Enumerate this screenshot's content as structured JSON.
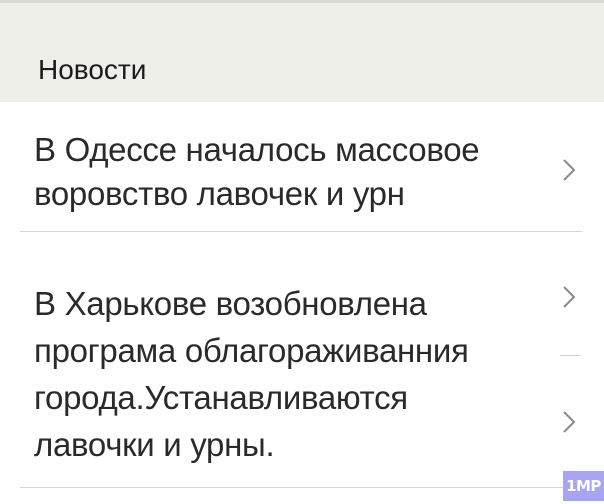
{
  "section": {
    "title": "Новости"
  },
  "news": [
    {
      "lines": [
        "В Одессе началось массовое",
        "воровство лавочек и урн"
      ]
    },
    {
      "lines": [
        "В Харькове возобновлена",
        "програма облагораживанния",
        "города.Устанавливаются",
        "лавочки и урны."
      ]
    }
  ],
  "watermark": {
    "text": "1MP"
  },
  "icons": {
    "chevron": "chevron-right-icon"
  },
  "colors": {
    "header_bg": "#efefe9",
    "text": "#2a2a2a",
    "chevron": "#8a8a8a",
    "divider": "#d4d4d4",
    "watermark_bg": "#a8a4f0"
  }
}
